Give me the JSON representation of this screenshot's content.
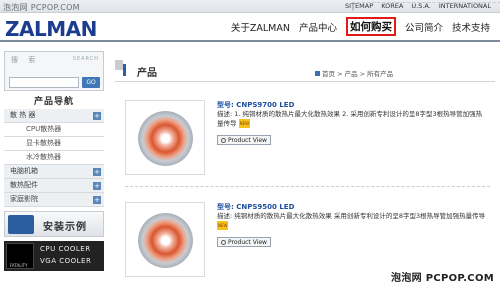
{
  "watermark": {
    "top": "泡泡网 PCPOP.COM",
    "bottom": "泡泡网 PCPOP.COM"
  },
  "top_links": [
    "SITEMAP",
    "KOREA",
    "U.S.A.",
    "INTERNATIONAL"
  ],
  "brand": "ZALMAN",
  "nav": [
    "关于ZALMAN",
    "产品中心",
    "如何购买",
    "公司简介",
    "技术支持"
  ],
  "sidebar": {
    "search_label": "搜 索",
    "search_brand": "SEARCH",
    "search_button": "GO",
    "title": "产品导航",
    "items": [
      {
        "label": "散 热 器",
        "plus": true,
        "sub": false
      },
      {
        "label": "CPU散热器",
        "plus": false,
        "sub": true
      },
      {
        "label": "显卡散热器",
        "plus": false,
        "sub": true
      },
      {
        "label": "水冷散热器",
        "plus": false,
        "sub": true
      },
      {
        "label": "电脑机箱",
        "plus": true,
        "sub": false
      },
      {
        "label": "散热配件",
        "plus": true,
        "sub": false
      },
      {
        "label": "家庭影院",
        "plus": true,
        "sub": false
      }
    ],
    "banner_install": "安装示例",
    "banner_fatality": "FATALITY",
    "banner_cpu": "CPU COOLER",
    "banner_vga": "VGA COOLER"
  },
  "main": {
    "title": "产品",
    "breadcrumb": "首页 > 产品 > 所有产品",
    "products": [
      {
        "model": "型号: CNPS9700 LED",
        "desc": "描述: 1. 纯铜材质的散热片最大化散热效果  2. 采用创新专利设计的呈8字型3根热导管加强热量传导",
        "badge": "NEW",
        "view": "Product View"
      },
      {
        "model": "型号: CNPS9500 LED",
        "desc": "描述: 纯铜材质的散热片最大化散热效果  采用创新专利设计的呈8字型3根热导管加强热量传导",
        "badge": "NEW",
        "view": "Product View"
      }
    ]
  }
}
